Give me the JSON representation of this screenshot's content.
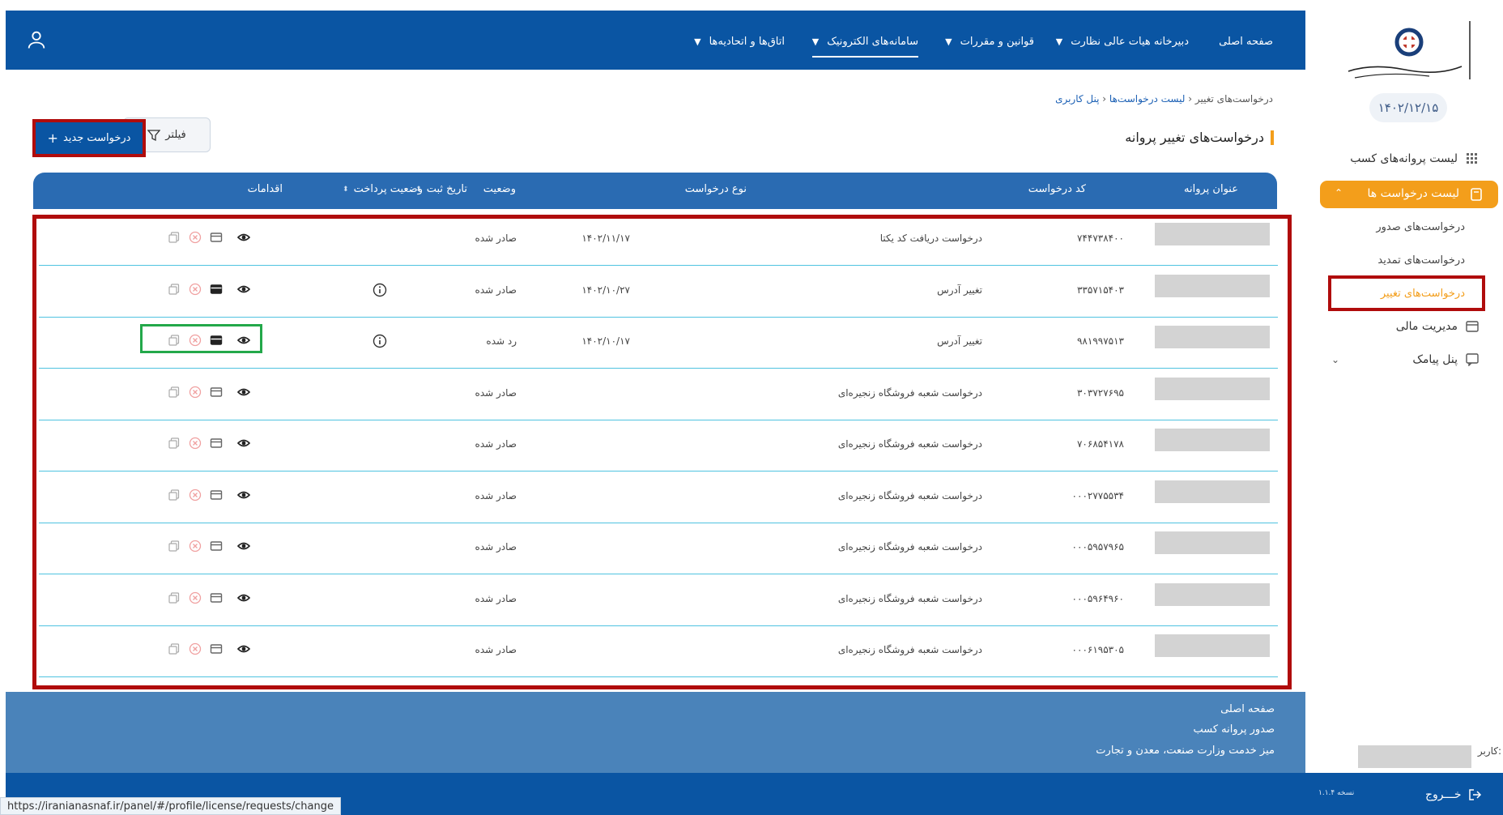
{
  "topnav": {
    "items": [
      {
        "label": "صفحه اصلی",
        "has_menu": false
      },
      {
        "label": "دبیرخانه هیات عالی نظارت",
        "has_menu": true
      },
      {
        "label": "قوانین و مقررات",
        "has_menu": true
      },
      {
        "label": "سامانه‌های الکترونیک",
        "has_menu": true,
        "active": true
      },
      {
        "label": "اتاق‌ها و اتحادیه‌ها",
        "has_menu": true
      }
    ],
    "user_icon": "user-icon"
  },
  "sidebar": {
    "date": "۱۴۰۲/۱۲/۱۵",
    "items": {
      "licenses": "لیست پروانه‌های کسب",
      "requests": "لیست درخواست ها",
      "sub_issue": "درخواست‌های صدور",
      "sub_renew": "درخواست‌های تمدید",
      "sub_change": "درخواست‌های تغییر",
      "finance": "مدیریت مالی",
      "sms": "پنل پیامک"
    }
  },
  "breadcrumb": {
    "root": "پنل کاربری",
    "mid": "لیست درخواست‌ها",
    "current": "درخواست‌های تغییر"
  },
  "page": {
    "title": "درخواست‌های تغییر پروانه",
    "filter_label": "فیلتر",
    "new_label": "درخواست جدید"
  },
  "table": {
    "headers": {
      "title": "عنوان پروانه",
      "code": "کد درخواست",
      "type": "نوع درخواست",
      "date": "تاریخ ثبت",
      "status": "وضعیت",
      "payment": "وضعیت پرداخت",
      "actions": "اقدامات"
    },
    "rows": [
      {
        "code": "۷۴۴۷۳۸۴۰۰",
        "type": "درخواست دریافت کد یکتا",
        "date": "۱۴۰۲/۱۱/۱۷",
        "status": "صادر شده",
        "pay_info": false,
        "card_active": false
      },
      {
        "code": "۳۳۵۷۱۵۴۰۳",
        "type": "تغییر آدرس",
        "date": "۱۴۰۲/۱۰/۲۷",
        "status": "صادر شده",
        "pay_info": true,
        "card_active": true
      },
      {
        "code": "۹۸۱۹۹۷۵۱۳",
        "type": "تغییر آدرس",
        "date": "۱۴۰۲/۱۰/۱۷",
        "status": "رد شده",
        "pay_info": true,
        "card_active": true
      },
      {
        "code": "۳۰۳۷۲۷۶۹۵",
        "type": "درخواست شعبه فروشگاه زنجیره‌ای",
        "date": "",
        "status": "صادر شده",
        "pay_info": false,
        "card_active": false
      },
      {
        "code": "۷۰۶۸۵۴۱۷۸",
        "type": "درخواست شعبه فروشگاه زنجیره‌ای",
        "date": "",
        "status": "صادر شده",
        "pay_info": false,
        "card_active": false
      },
      {
        "code": "۰۰۰۲۷۷۵۵۳۴",
        "type": "درخواست شعبه فروشگاه زنجیره‌ای",
        "date": "",
        "status": "صادر شده",
        "pay_info": false,
        "card_active": false
      },
      {
        "code": "۰۰۰۵۹۵۷۹۶۵",
        "type": "درخواست شعبه فروشگاه زنجیره‌ای",
        "date": "",
        "status": "صادر شده",
        "pay_info": false,
        "card_active": false
      },
      {
        "code": "۰۰۰۵۹۶۴۹۶۰",
        "type": "درخواست شعبه فروشگاه زنجیره‌ای",
        "date": "",
        "status": "صادر شده",
        "pay_info": false,
        "card_active": false
      },
      {
        "code": "۰۰۰۶۱۹۵۳۰۵",
        "type": "درخواست شعبه فروشگاه زنجیره‌ای",
        "date": "",
        "status": "صادر شده",
        "pay_info": false,
        "card_active": false
      }
    ]
  },
  "footer": {
    "links": [
      "صفحه اصلی",
      "صدور پروانه کسب",
      "میز خدمت وزارت صنعت، معدن و تجارت"
    ],
    "user_label": "کاربر:",
    "logout": "خـــروج",
    "version": "نسخه ۱.۱.۴"
  },
  "status_url": "https://iranianasnaf.ir/panel/#/profile/license/requests/change",
  "colors": {
    "primary": "#0a55a3",
    "accent": "#f39e1b",
    "highlight_red": "#b00c0c",
    "highlight_green": "#23a84a",
    "danger": "#e25b5b"
  }
}
